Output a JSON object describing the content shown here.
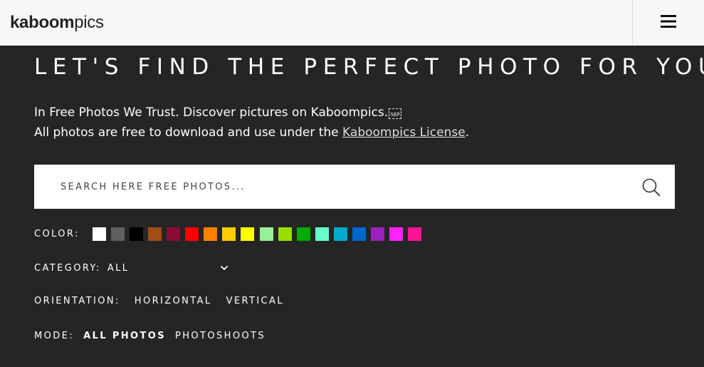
{
  "header": {
    "logo_bold": "kaboom",
    "logo_light": "pics",
    "menu_icon": "hamburger-icon"
  },
  "hero": {
    "headline": "LET'S FIND THE PERFECT PHOTO FOR YOU",
    "line1": "In Free Photos We Trust. Discover pictures on Kaboompics.",
    "sep_glyph": "SEP",
    "line2_prefix": "All photos are free to download and use under the ",
    "license_link": "Kaboompics License",
    "line2_suffix": "."
  },
  "search": {
    "placeholder": "SEARCH HERE FREE PHOTOS...",
    "value": "",
    "icon": "search-icon"
  },
  "filters": {
    "color_label": "COLOR:",
    "colors": [
      "#ffffff",
      "#5f5f5f",
      "#000000",
      "#a14d16",
      "#8b0b35",
      "#ff0000",
      "#ff7f00",
      "#ffcc00",
      "#ffff00",
      "#99ee99",
      "#99dd00",
      "#00aa00",
      "#66ffcc",
      "#00aacc",
      "#0066cc",
      "#9922bb",
      "#ff22ff",
      "#ff1493"
    ],
    "category_label": "CATEGORY:",
    "category_value": "ALL",
    "orientation_label": "ORIENTATION:",
    "orientation_options": [
      "HORIZONTAL",
      "VERTICAL"
    ],
    "mode_label": "MODE:",
    "mode_options": [
      "ALL PHOTOS",
      "PHOTOSHOOTS"
    ],
    "mode_selected": "ALL PHOTOS"
  }
}
